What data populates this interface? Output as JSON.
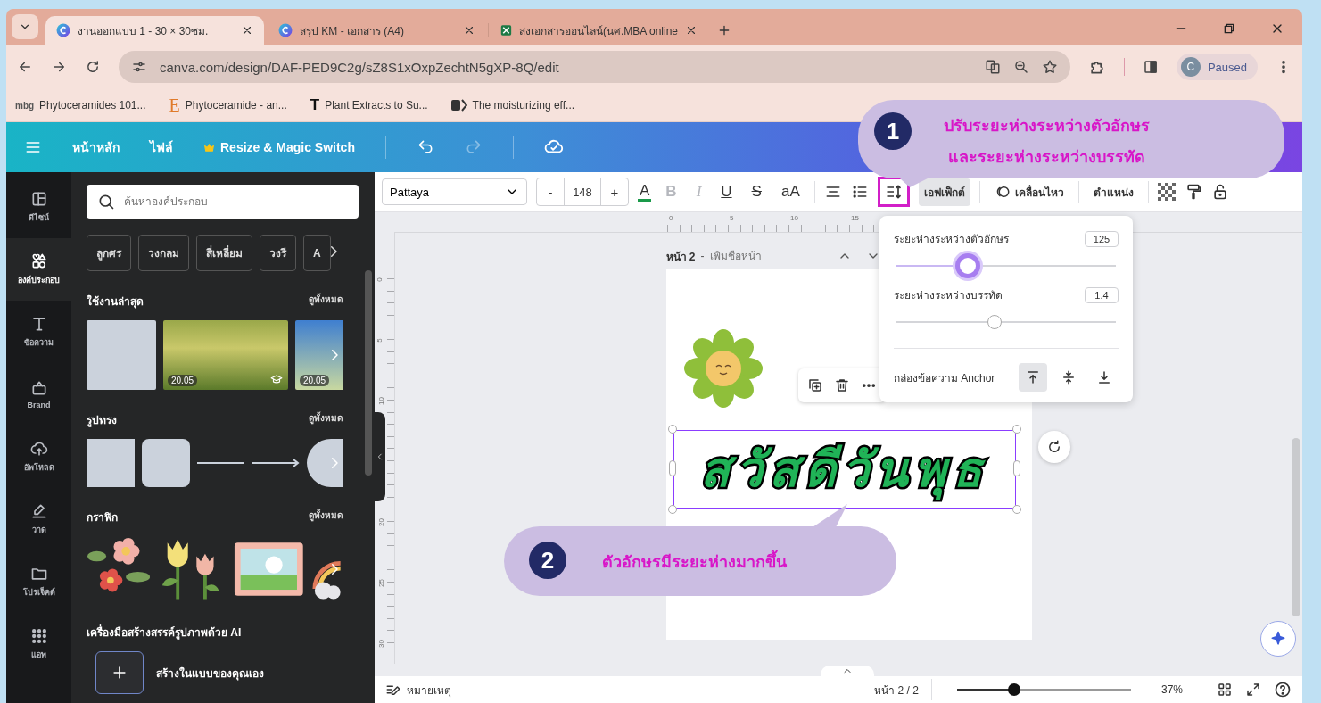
{
  "browser": {
    "tabs": [
      {
        "title": "งานออกแบบ 1 - 30 × 30ซม.",
        "kind": "canva",
        "selected": true
      },
      {
        "title": "สรุป KM - เอกสาร (A4)",
        "kind": "canva",
        "selected": false
      },
      {
        "title": "ส่งเอกสารออนไลน์(นศ.MBA online",
        "kind": "sheet",
        "selected": false
      }
    ],
    "url": "canva.com/design/DAF-PED9C2g/sZ8S1xOxpZechtN5gXP-8Q/edit",
    "profile": {
      "initial": "C",
      "status": "Paused"
    },
    "bookmarks": [
      {
        "badge": "mbg",
        "title": "Phytoceramides 101..."
      },
      {
        "badge": "E",
        "title": "Phytoceramide - an..."
      },
      {
        "badge": "T",
        "title": "Plant Extracts to Su..."
      },
      {
        "title": "The moisturizing eff..."
      }
    ]
  },
  "header": {
    "menu": [
      "หน้าหลัก",
      "ไฟล์"
    ],
    "resize": "Resize & Magic Switch",
    "redo_disabled": true
  },
  "rail": [
    {
      "kind": "design",
      "label": "ดีไซน์",
      "selected": false
    },
    {
      "kind": "elements",
      "label": "องค์ประกอบ",
      "selected": true
    },
    {
      "kind": "text",
      "label": "ข้อความ",
      "selected": false
    },
    {
      "kind": "brand",
      "label": "Brand",
      "selected": false
    },
    {
      "kind": "upload",
      "label": "อัพโหลด",
      "selected": false
    },
    {
      "kind": "draw",
      "label": "วาด",
      "selected": false
    },
    {
      "kind": "projects",
      "label": "โปรเจ็คต์",
      "selected": false
    },
    {
      "kind": "apps",
      "label": "แอพ",
      "selected": false
    }
  ],
  "panel": {
    "search_placeholder": "ค้นหาองค์ประกอบ",
    "chips": [
      "ลูกศร",
      "วงกลม",
      "สี่เหลี่ยม",
      "วงรี",
      "A"
    ],
    "sections": [
      {
        "kind": "recent",
        "title": "ใช้งานล่าสุด",
        "see_all": "ดูทั้งหมด",
        "badges": [
          "20.05",
          "20.05"
        ]
      },
      {
        "kind": "shapes",
        "title": "รูปทรง",
        "see_all": "ดูทั้งหมด"
      },
      {
        "kind": "graphics",
        "title": "กราฟิก",
        "see_all": "ดูทั้งหมด"
      },
      {
        "kind": "ai",
        "title": "เครื่องมือสร้างสรรค์รูปภาพด้วย AI",
        "action": "สร้างในแบบของคุณเอง"
      }
    ]
  },
  "toolbar": {
    "font": "Pattaya",
    "minus": "-",
    "size": "148",
    "plus": "+",
    "format": [
      {
        "label": "A",
        "kind": "color",
        "disabled": false
      },
      {
        "label": "B",
        "kind": "bold",
        "disabled": true
      },
      {
        "label": "I",
        "kind": "italic",
        "disabled": true
      },
      {
        "label": "U",
        "kind": "underline",
        "disabled": false
      },
      {
        "label": "S",
        "kind": "strike",
        "disabled": false
      },
      {
        "label": "aA",
        "kind": "case",
        "disabled": false
      }
    ],
    "spacing_highlighted": true,
    "effects": "เอฟเฟ็กต์",
    "animate": "เคลื่อนไหว",
    "position": "ตำแหน่ง"
  },
  "rulers": {
    "horizontal": [
      "0",
      "5",
      "10",
      "15"
    ],
    "vertical": [
      "0",
      "5",
      "10",
      "20",
      "25",
      "30"
    ]
  },
  "page": {
    "title": "หน้า 2",
    "separator": "-",
    "name_placeholder": "เพิ่มชื่อหน้า",
    "text": "สวัสดีวันพุธ"
  },
  "spacing_popup": {
    "letter": {
      "label": "ระยะห่างระหว่างตัวอักษร",
      "value": "125",
      "level": 0.33
    },
    "line": {
      "label": "ระยะห่างระหว่างบรรทัด",
      "value": "1.4",
      "level": 0.45
    },
    "anchor_label": "กล่องข้อความ Anchor",
    "anchors": [
      {
        "kind": "top",
        "selected": true
      },
      {
        "kind": "middle",
        "selected": false
      },
      {
        "kind": "bottom",
        "selected": false
      }
    ]
  },
  "bottom": {
    "notes": "หมายเหตุ",
    "page": "หน้า 2 / 2",
    "zoom": {
      "level": 0.33,
      "reading": "37%"
    }
  },
  "callouts": [
    {
      "number": "1",
      "lines": [
        "ปรับระยะห่างระหว่างตัวอักษร",
        "และระยะห่างระหว่างบรรทัด"
      ]
    },
    {
      "number": "2",
      "lines": [
        "ตัวอักษรมีระยะห่างมากขึ้น"
      ]
    }
  ]
}
